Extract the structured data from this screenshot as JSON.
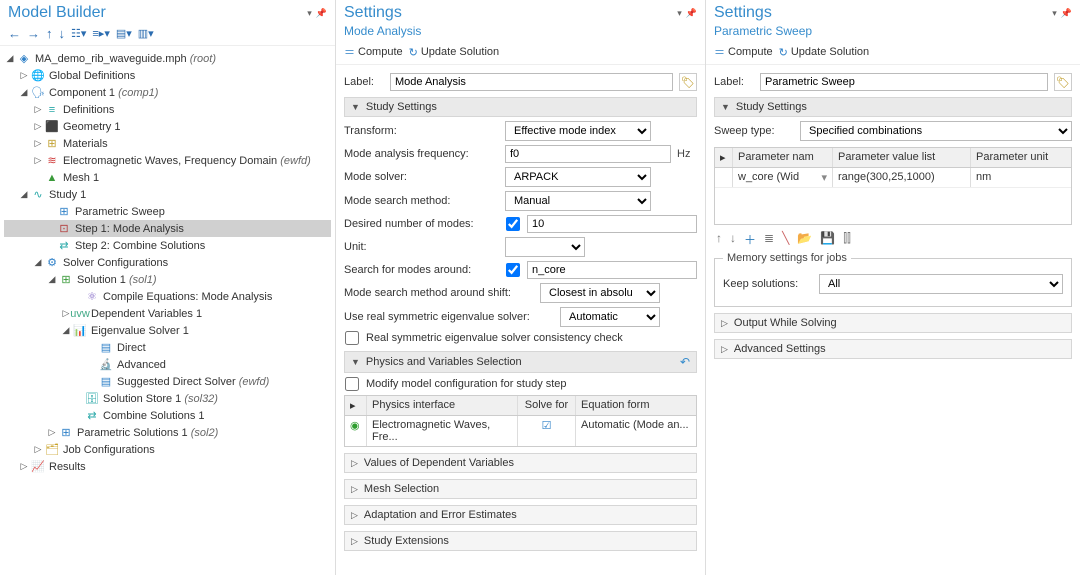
{
  "panel1": {
    "title": "Model Builder",
    "tree": {
      "root": "MA_demo_rib_waveguide.mph",
      "root_suffix": "(root)",
      "global": "Global Definitions",
      "comp": "Component 1",
      "comp_suffix": "(comp1)",
      "defs": "Definitions",
      "geom": "Geometry 1",
      "mats": "Materials",
      "ew": "Electromagnetic Waves, Frequency Domain",
      "ew_suffix": "(ewfd)",
      "mesh": "Mesh 1",
      "study": "Study 1",
      "psweep": "Parametric Sweep",
      "step1": "Step 1: Mode Analysis",
      "step2": "Step 2: Combine Solutions",
      "solver": "Solver Configurations",
      "sol1": "Solution 1",
      "sol1_suffix": "(sol1)",
      "compile": "Compile Equations: Mode Analysis",
      "depvars": "Dependent Variables 1",
      "eig": "Eigenvalue Solver 1",
      "direct": "Direct",
      "adv": "Advanced",
      "sugg": "Suggested Direct Solver",
      "sugg_suffix": "(ewfd)",
      "store": "Solution Store 1",
      "store_suffix": "(sol32)",
      "combine": "Combine Solutions 1",
      "psol": "Parametric Solutions 1",
      "psol_suffix": "(sol2)",
      "jobs": "Job Configurations",
      "results": "Results"
    }
  },
  "panel2": {
    "title": "Settings",
    "subtitle": "Mode Analysis",
    "compute": "Compute",
    "update": "Update Solution",
    "label_lbl": "Label:",
    "label_val": "Mode Analysis",
    "sec_study": "Study Settings",
    "f_transform": "Transform:",
    "v_transform": "Effective mode index",
    "f_freq": "Mode analysis frequency:",
    "v_freq": "f0",
    "f_freq_unit": "Hz",
    "f_solver": "Mode solver:",
    "v_solver": "ARPACK",
    "f_search": "Mode search method:",
    "v_search": "Manual",
    "f_modes": "Desired number of modes:",
    "v_modes": "10",
    "f_unit": "Unit:",
    "v_unit": "",
    "f_around": "Search for modes around:",
    "v_around": "n_core",
    "f_shift": "Mode search method around shift:",
    "v_shift": "Closest in absolu",
    "f_realsym": "Use real symmetric eigenvalue solver:",
    "v_realsym": "Automatic",
    "ck_consistency": "Real symmetric eigenvalue solver consistency check",
    "sec_phys": "Physics and Variables Selection",
    "ck_modify": "Modify model configuration for study step",
    "ph_col2": "Physics interface",
    "ph_col3": "Solve for",
    "ph_col4": "Equation form",
    "ph_r1_2": "Electromagnetic Waves, Fre...",
    "ph_r1_4": "Automatic (Mode an...",
    "sec_dep": "Values of Dependent Variables",
    "sec_mesh": "Mesh Selection",
    "sec_adapt": "Adaptation and Error Estimates",
    "sec_ext": "Study Extensions"
  },
  "panel3": {
    "title": "Settings",
    "subtitle": "Parametric Sweep",
    "compute": "Compute",
    "update": "Update Solution",
    "label_lbl": "Label:",
    "label_val": "Parametric Sweep",
    "sec_study": "Study Settings",
    "sweep_lbl": "Sweep type:",
    "sweep_val": "Specified combinations",
    "col1": "Parameter nam",
    "col2": "Parameter value list",
    "col3": "Parameter unit",
    "r1c1": "w_core (Wid",
    "r1c2": "range(300,25,1000)",
    "r1c3": "nm",
    "legend": "Memory settings for jobs",
    "keep_lbl": "Keep solutions:",
    "keep_val": "All",
    "sec_out": "Output While Solving",
    "sec_adv": "Advanced Settings"
  }
}
